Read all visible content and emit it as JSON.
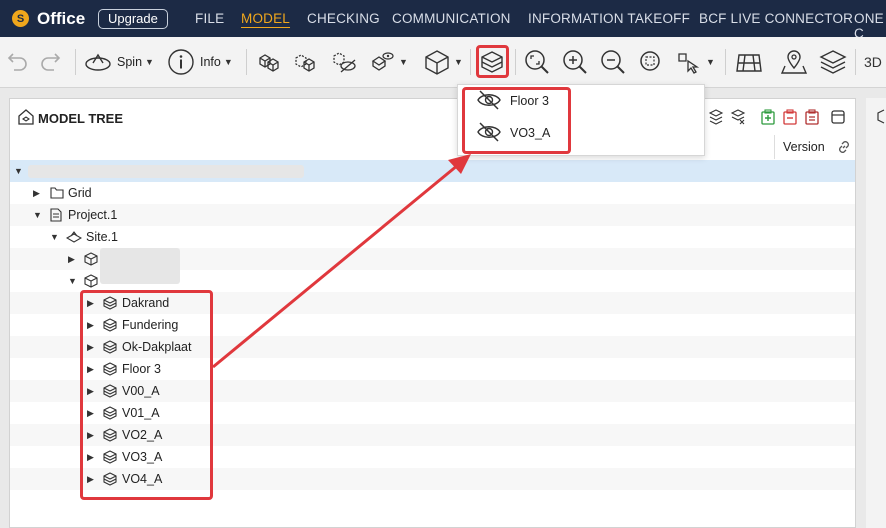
{
  "topnav": {
    "logo_letter": "S",
    "app_name": "Office",
    "upgrade_label": "Upgrade",
    "menu": [
      "FILE",
      "MODEL",
      "CHECKING",
      "COMMUNICATION",
      "INFORMATION TAKEOFF",
      "BCF LIVE CONNECTOR",
      "ONE C"
    ],
    "active_menu": "MODEL"
  },
  "toolbar": {
    "spin_label": "Spin",
    "info_label": "Info",
    "mode_3d": "3D"
  },
  "panel": {
    "title": "MODEL TREE",
    "version_header": "Version"
  },
  "tree": {
    "grid": "Grid",
    "project": "Project.1",
    "site": "Site.1",
    "storeys": [
      "Dakrand",
      "Fundering",
      "Ok-Dakplaat",
      "Floor 3",
      "V00_A",
      "V01_A",
      "VO2_A",
      "VO3_A",
      "VO4_A"
    ]
  },
  "dropdown": {
    "items": [
      "Floor 3",
      "VO3_A"
    ]
  },
  "colors": {
    "nav_bg": "#1c2a45",
    "accent": "#f0a71c",
    "highlight": "#e0383d",
    "selected_row": "#d8e9f8"
  }
}
